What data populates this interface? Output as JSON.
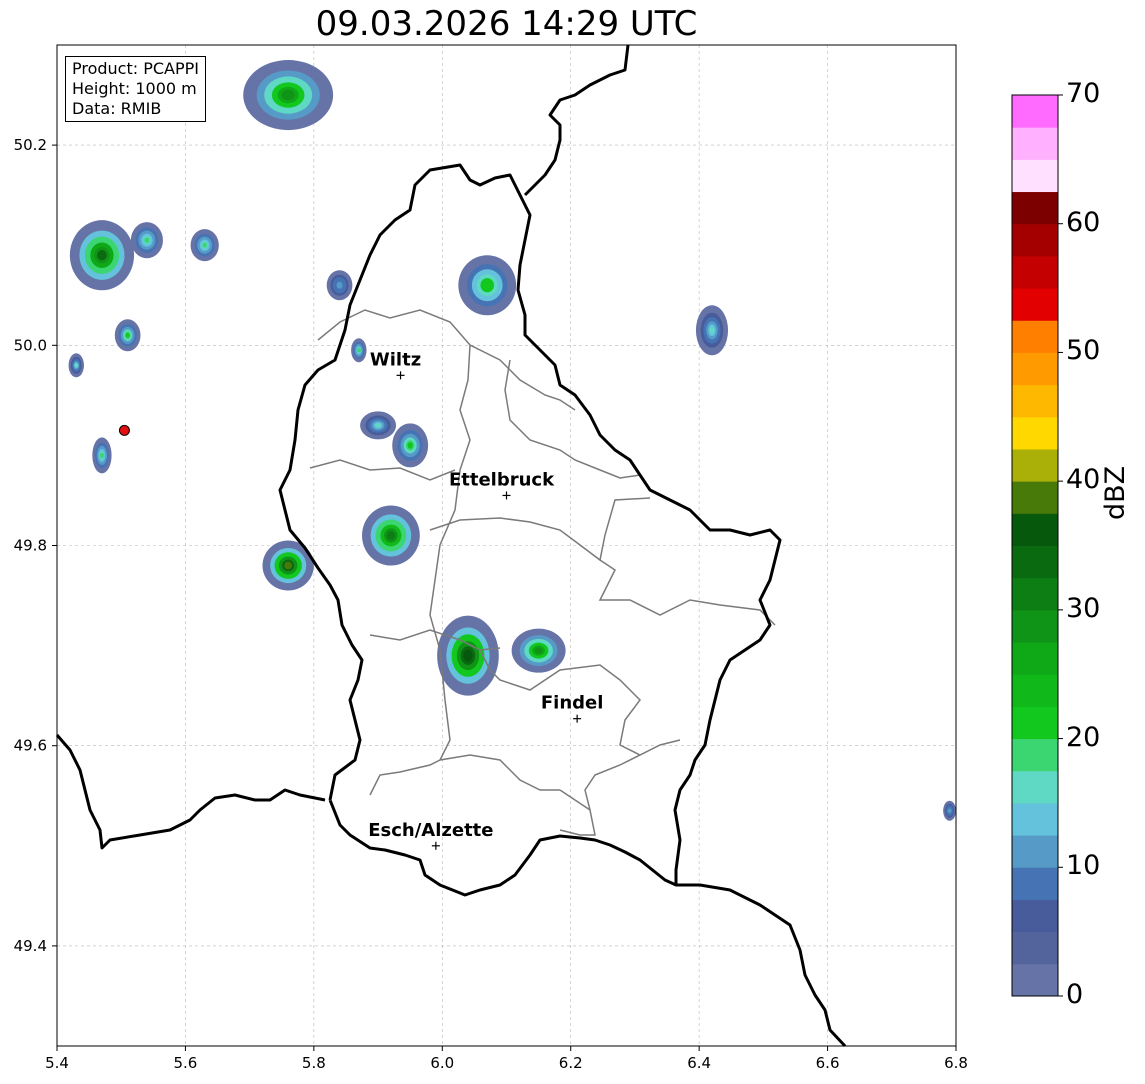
{
  "title": "09.03.2026 14:29 UTC",
  "info": {
    "product": "Product: PCAPPI",
    "height": "Height: 1000 m",
    "source": "Data: RMIB"
  },
  "map": {
    "lon_range": [
      5.4,
      6.8
    ],
    "lat_range": [
      49.3,
      50.3
    ],
    "x_ticks": [
      "5.4",
      "5.6",
      "5.8",
      "6.0",
      "6.2",
      "6.4",
      "6.6",
      "6.8"
    ],
    "y_ticks": [
      "49.4",
      "49.6",
      "49.8",
      "50.0",
      "50.2"
    ],
    "cities": [
      {
        "name": "Wiltz",
        "lon": 5.935,
        "lat": 49.97
      },
      {
        "name": "Ettelbruck",
        "lon": 6.1,
        "lat": 49.85
      },
      {
        "name": "Findel",
        "lon": 6.21,
        "lat": 49.627
      },
      {
        "name": "Esch/Alzette",
        "lon": 5.99,
        "lat": 49.5
      }
    ],
    "radar_site": {
      "lon": 5.505,
      "lat": 49.915,
      "color": "#e01010"
    },
    "echo_cells": [
      {
        "lon": 5.76,
        "lat": 50.25,
        "rx": 0.07,
        "ry": 0.035,
        "peak": 28
      },
      {
        "lon": 5.47,
        "lat": 50.09,
        "rx": 0.05,
        "ry": 0.035,
        "peak": 33
      },
      {
        "lon": 5.54,
        "lat": 50.105,
        "rx": 0.025,
        "ry": 0.018,
        "peak": 18
      },
      {
        "lon": 5.63,
        "lat": 50.1,
        "rx": 0.022,
        "ry": 0.016,
        "peak": 18
      },
      {
        "lon": 5.51,
        "lat": 50.01,
        "rx": 0.02,
        "ry": 0.016,
        "peak": 20
      },
      {
        "lon": 5.43,
        "lat": 49.98,
        "rx": 0.012,
        "ry": 0.012,
        "peak": 15
      },
      {
        "lon": 5.47,
        "lat": 49.89,
        "rx": 0.015,
        "ry": 0.018,
        "peak": 18
      },
      {
        "lon": 6.07,
        "lat": 50.06,
        "rx": 0.045,
        "ry": 0.03,
        "peak": 22
      },
      {
        "lon": 6.42,
        "lat": 50.015,
        "rx": 0.025,
        "ry": 0.025,
        "peak": 15
      },
      {
        "lon": 5.9,
        "lat": 49.92,
        "rx": 0.028,
        "ry": 0.014,
        "peak": 15
      },
      {
        "lon": 5.95,
        "lat": 49.9,
        "rx": 0.028,
        "ry": 0.022,
        "peak": 20
      },
      {
        "lon": 5.92,
        "lat": 49.81,
        "rx": 0.045,
        "ry": 0.03,
        "peak": 32
      },
      {
        "lon": 5.76,
        "lat": 49.78,
        "rx": 0.04,
        "ry": 0.025,
        "peak": 38
      },
      {
        "lon": 6.04,
        "lat": 49.69,
        "rx": 0.048,
        "ry": 0.04,
        "peak": 37
      },
      {
        "lon": 6.15,
        "lat": 49.695,
        "rx": 0.042,
        "ry": 0.022,
        "peak": 28
      },
      {
        "lon": 6.79,
        "lat": 49.535,
        "rx": 0.01,
        "ry": 0.01,
        "peak": 12
      },
      {
        "lon": 5.84,
        "lat": 50.06,
        "rx": 0.02,
        "ry": 0.015,
        "peak": 12
      },
      {
        "lon": 5.87,
        "lat": 49.995,
        "rx": 0.012,
        "ry": 0.012,
        "peak": 18
      }
    ]
  },
  "colorbar": {
    "unit": "dBZ",
    "min": 0,
    "max": 70,
    "step": 2.5,
    "labels": [
      "0",
      "10",
      "20",
      "30",
      "40",
      "50",
      "60",
      "70"
    ],
    "colors": [
      "#6673a6",
      "#53649c",
      "#485c9c",
      "#4573b3",
      "#569ac7",
      "#64c2dc",
      "#5fd8c4",
      "#3bd672",
      "#12c81e",
      "#10b81a",
      "#0fa817",
      "#109418",
      "#0c7e14",
      "#0a6a10",
      "#06580c",
      "#477a08",
      "#aab008",
      "#ffd800",
      "#ffb800",
      "#ff9a00",
      "#ff7f00",
      "#e20000",
      "#c40000",
      "#a40000",
      "#7d0000",
      "#ffe0ff",
      "#ffb0ff",
      "#ff6bff",
      "#ee32ee"
    ]
  },
  "colors": {
    "border": "#000000",
    "canton": "#7a7a7a",
    "grid": "#b8b8b8"
  }
}
